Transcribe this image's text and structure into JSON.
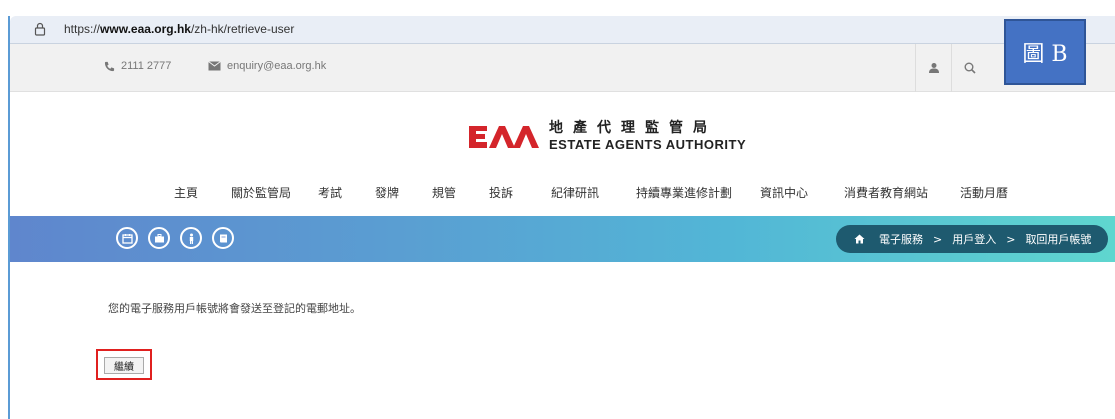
{
  "browser": {
    "url_prefix": "https://",
    "url_host": "www.eaa.org.hk",
    "url_path": "/zh-hk/retrieve-user"
  },
  "contact": {
    "phone": "2111 2777",
    "email": "enquiry@eaa.org.hk"
  },
  "figure_label": "圖 B",
  "logo": {
    "zh": "地產代理監管局",
    "en": "ESTATE AGENTS AUTHORITY"
  },
  "nav": {
    "items": [
      "主頁",
      "關於監管局",
      "考試",
      "發牌",
      "規管",
      "投訴",
      "紀律研訊",
      "持續專業進修計劃",
      "資訊中心",
      "消費者教育網站",
      "活動月曆"
    ]
  },
  "breadcrumb": {
    "items": [
      "電子服務",
      "用戶登入",
      "取回用戶帳號"
    ],
    "separator": ">"
  },
  "content": {
    "message": "您的電子服務用戶帳號將會發送至登記的電郵地址。",
    "continue_label": "繼續"
  },
  "colors": {
    "brand_red": "#d4252b",
    "highlight_red": "#e0201f",
    "label_blue": "#4472c4",
    "breadcrumb_bg": "#1e5a6f"
  }
}
